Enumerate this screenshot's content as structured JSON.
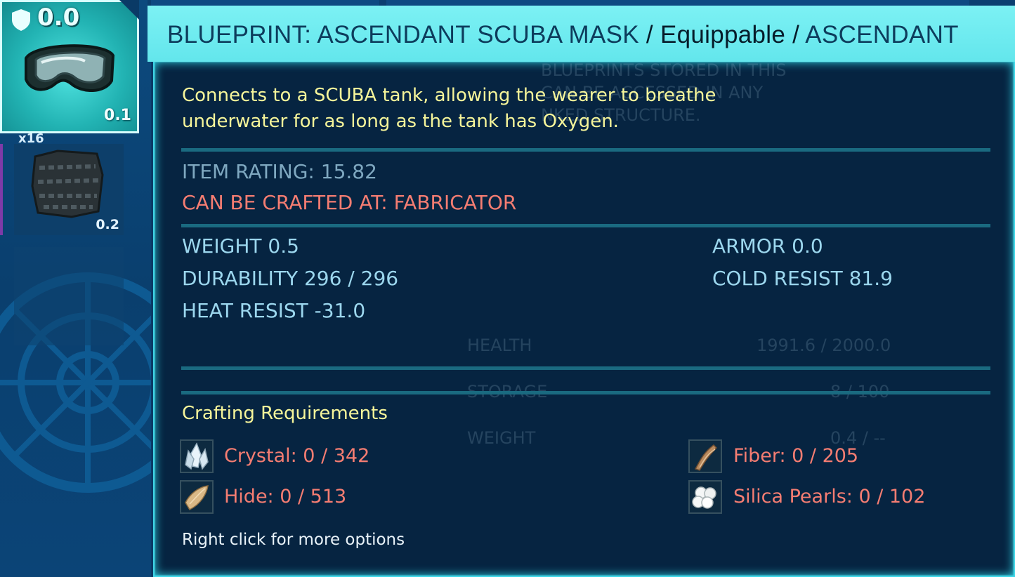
{
  "inventory": {
    "selected_slot": {
      "armor": "0.0",
      "weight": "0.1",
      "icon": "scuba-mask-icon"
    },
    "slot_2": {
      "quantity": "x16",
      "weight": "0.2",
      "icon": "hide-icon"
    }
  },
  "tooltip": {
    "title_prefix": "BLUEPRINT: ASCENDANT SCUBA MASK",
    "title_sep1": " / ",
    "title_type": "Equippable",
    "title_sep2": " / ",
    "title_quality": "ASCENDANT",
    "description": "Connects to a SCUBA tank, allowing the wearer to breathe underwater for as long as the tank has Oxygen.",
    "item_rating": "ITEM RATING: 15.82",
    "crafted_at": "CAN BE CRAFTED AT: FABRICATOR",
    "stats_left": [
      "WEIGHT 0.5",
      "DURABILITY 296 / 296",
      "HEAT RESIST -31.0"
    ],
    "stats_right": [
      "ARMOR 0.0",
      "COLD RESIST 81.9"
    ],
    "requirements_title": "Crafting Requirements",
    "requirements": [
      {
        "label": "Crystal: 0 / 342",
        "icon": "crystal-icon"
      },
      {
        "label": "Fiber: 0 / 205",
        "icon": "fiber-icon"
      },
      {
        "label": "Hide: 0 / 513",
        "icon": "hide-icon"
      },
      {
        "label": "Silica Pearls: 0 / 102",
        "icon": "silica-pearls-icon"
      }
    ],
    "hint": "Right click for more options"
  },
  "background_panel": {
    "ghost_text_1": "BLUEPRINTS STORED IN THIS",
    "ghost_text_2": "CAN BE ACCESSED IN ANY",
    "ghost_text_3": "NKED STRUCTURE.",
    "health_label": "HEALTH",
    "health_value": "1991.6 / 2000.0",
    "storage_label": "STORAGE",
    "storage_value": "8 / 100",
    "weight_label": "WEIGHT",
    "weight_value": "0.4 / --"
  },
  "colors": {
    "title_bar": "#6ce9ee",
    "description": "#f6f59a",
    "missing_resource": "#f57d72",
    "stat": "#9cd7ee"
  }
}
